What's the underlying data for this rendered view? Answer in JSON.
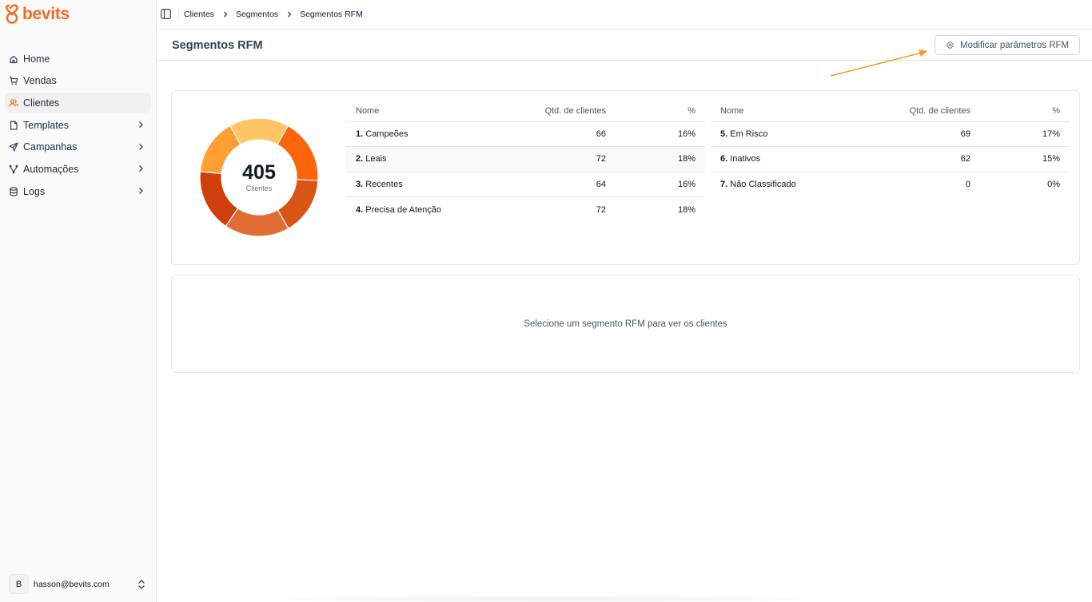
{
  "app": {
    "brand": "bevits",
    "accent": "#f26a21"
  },
  "sidebar": {
    "items": [
      {
        "label": "Home",
        "icon": "home-icon",
        "active": false,
        "has_children": false
      },
      {
        "label": "Vendas",
        "icon": "cart-icon",
        "active": false,
        "has_children": false
      },
      {
        "label": "Clientes",
        "icon": "users-icon",
        "active": true,
        "has_children": false
      },
      {
        "label": "Templates",
        "icon": "file-icon",
        "active": false,
        "has_children": true
      },
      {
        "label": "Campanhas",
        "icon": "send-icon",
        "active": false,
        "has_children": true
      },
      {
        "label": "Automações",
        "icon": "workflow-icon",
        "active": false,
        "has_children": true
      },
      {
        "label": "Logs",
        "icon": "database-icon",
        "active": false,
        "has_children": true
      }
    ],
    "user": {
      "initial": "B",
      "email": "hasson@bevits.com"
    }
  },
  "breadcrumb": [
    "Clientes",
    "Segmentos",
    "Segmentos RFM"
  ],
  "page": {
    "title": "Segmentos RFM",
    "modify_button": "Modificar parâmetros RFM"
  },
  "summary": {
    "total": "405",
    "label": "Clientes"
  },
  "table_headers": {
    "name": "Nome",
    "count": "Qtd. de clientes",
    "pct": "%"
  },
  "segments_left": [
    {
      "num": "1.",
      "name": "Campeões",
      "count": "66",
      "pct": "16%"
    },
    {
      "num": "2.",
      "name": "Leais",
      "count": "72",
      "pct": "18%"
    },
    {
      "num": "3.",
      "name": "Recentes",
      "count": "64",
      "pct": "16%"
    },
    {
      "num": "4.",
      "name": "Precisa de Atenção",
      "count": "72",
      "pct": "18%"
    }
  ],
  "segments_right": [
    {
      "num": "5.",
      "name": "Em Risco",
      "count": "69",
      "pct": "17%"
    },
    {
      "num": "6.",
      "name": "Inativos",
      "count": "62",
      "pct": "15%"
    },
    {
      "num": "7.",
      "name": "Não Classificado",
      "count": "0",
      "pct": "0%"
    }
  ],
  "donut_colors": [
    "#ffc466",
    "#fd6309",
    "#d95515",
    "#e06e34",
    "#cf3f0c",
    "#ff9e33",
    "#e5e7eb"
  ],
  "empty_state": "Selecione um segmento RFM para ver os clientes",
  "annotation_color": "#f59a2a"
}
